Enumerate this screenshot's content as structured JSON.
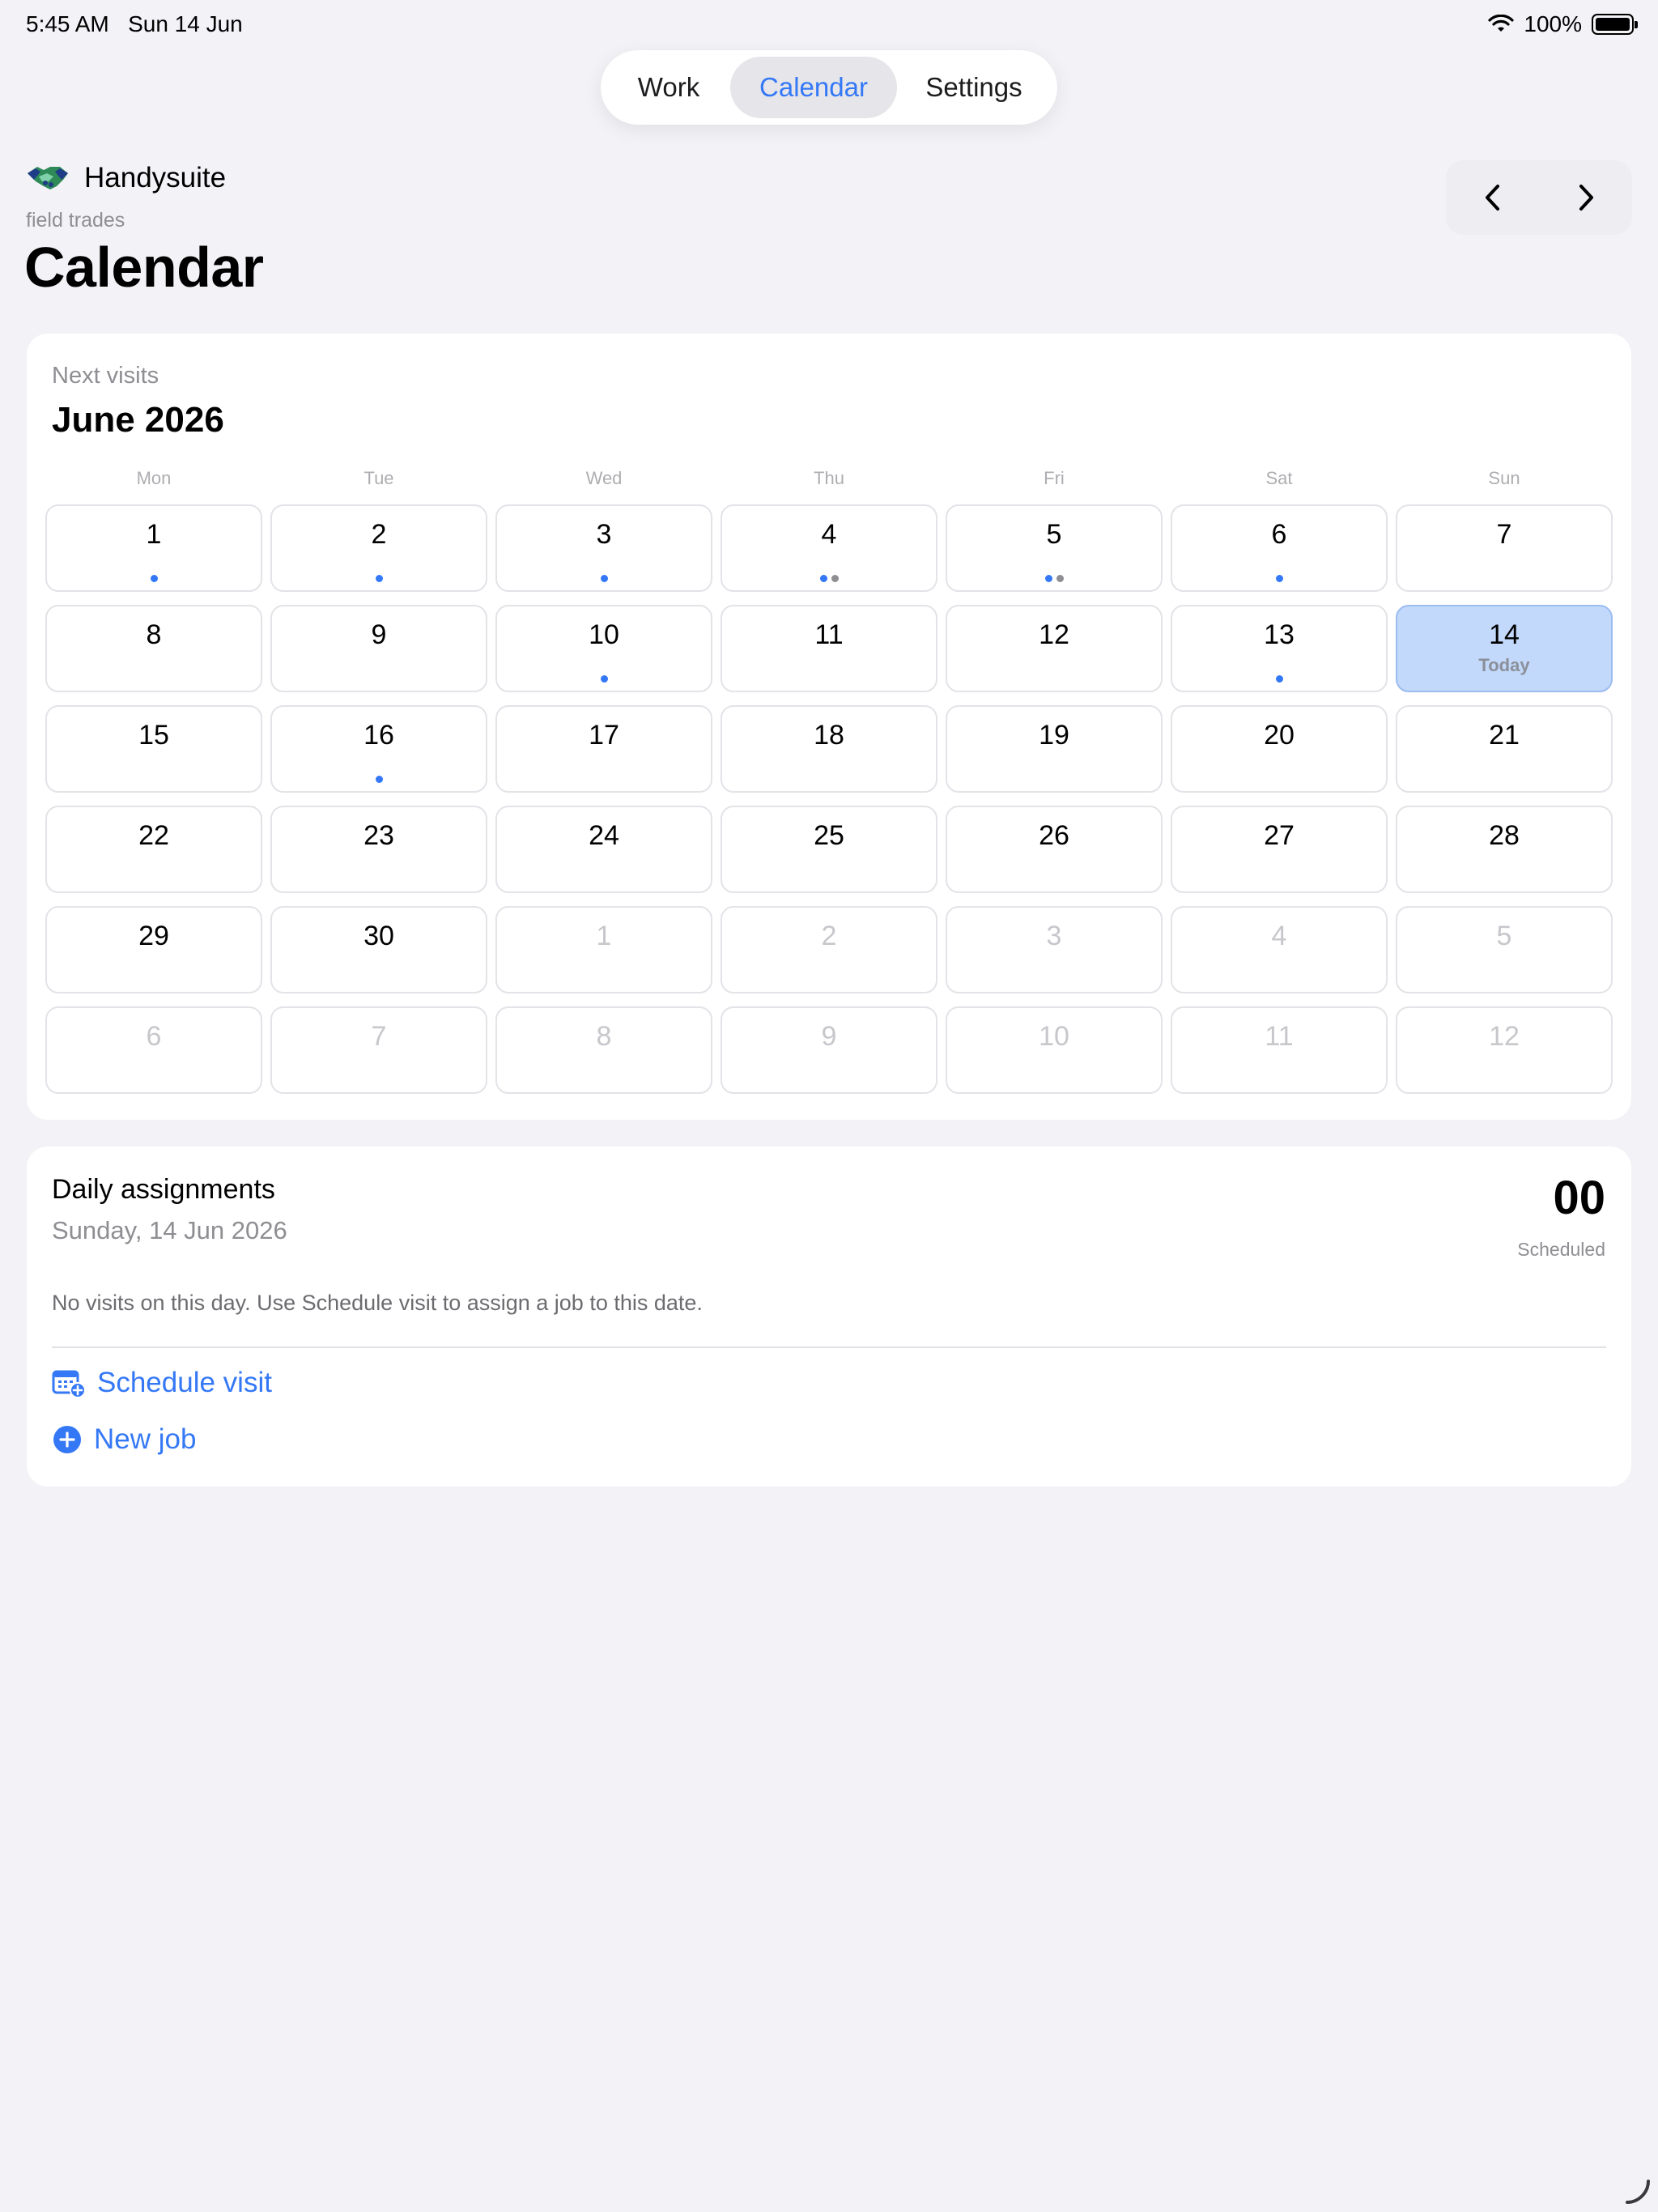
{
  "status_bar": {
    "time": "5:45 AM",
    "date": "Sun 14 Jun",
    "battery": "100%"
  },
  "tabs": [
    {
      "label": "Work",
      "selected": false
    },
    {
      "label": "Calendar",
      "selected": true
    },
    {
      "label": "Settings",
      "selected": false
    }
  ],
  "header": {
    "brand_name": "Handysuite",
    "brand_subtitle": "field trades",
    "title": "Calendar"
  },
  "calendar": {
    "overline": "Next visits",
    "month_label": "June 2026",
    "weekdays": [
      "Mon",
      "Tue",
      "Wed",
      "Thu",
      "Fri",
      "Sat",
      "Sun"
    ],
    "today_label": "Today",
    "days": [
      {
        "n": "1",
        "other": false,
        "dots": [
          "blue"
        ]
      },
      {
        "n": "2",
        "other": false,
        "dots": [
          "blue"
        ]
      },
      {
        "n": "3",
        "other": false,
        "dots": [
          "blue"
        ]
      },
      {
        "n": "4",
        "other": false,
        "dots": [
          "blue",
          "gray"
        ]
      },
      {
        "n": "5",
        "other": false,
        "dots": [
          "blue",
          "gray"
        ]
      },
      {
        "n": "6",
        "other": false,
        "dots": [
          "blue"
        ]
      },
      {
        "n": "7",
        "other": false,
        "dots": []
      },
      {
        "n": "8",
        "other": false,
        "dots": []
      },
      {
        "n": "9",
        "other": false,
        "dots": []
      },
      {
        "n": "10",
        "other": false,
        "dots": [
          "blue"
        ]
      },
      {
        "n": "11",
        "other": false,
        "dots": []
      },
      {
        "n": "12",
        "other": false,
        "dots": []
      },
      {
        "n": "13",
        "other": false,
        "dots": [
          "blue"
        ]
      },
      {
        "n": "14",
        "other": false,
        "today": true,
        "dots": []
      },
      {
        "n": "15",
        "other": false,
        "dots": []
      },
      {
        "n": "16",
        "other": false,
        "dots": [
          "blue"
        ]
      },
      {
        "n": "17",
        "other": false,
        "dots": []
      },
      {
        "n": "18",
        "other": false,
        "dots": []
      },
      {
        "n": "19",
        "other": false,
        "dots": []
      },
      {
        "n": "20",
        "other": false,
        "dots": []
      },
      {
        "n": "21",
        "other": false,
        "dots": []
      },
      {
        "n": "22",
        "other": false,
        "dots": []
      },
      {
        "n": "23",
        "other": false,
        "dots": []
      },
      {
        "n": "24",
        "other": false,
        "dots": []
      },
      {
        "n": "25",
        "other": false,
        "dots": []
      },
      {
        "n": "26",
        "other": false,
        "dots": []
      },
      {
        "n": "27",
        "other": false,
        "dots": []
      },
      {
        "n": "28",
        "other": false,
        "dots": []
      },
      {
        "n": "29",
        "other": false,
        "dots": []
      },
      {
        "n": "30",
        "other": false,
        "dots": []
      },
      {
        "n": "1",
        "other": true,
        "dots": []
      },
      {
        "n": "2",
        "other": true,
        "dots": []
      },
      {
        "n": "3",
        "other": true,
        "dots": []
      },
      {
        "n": "4",
        "other": true,
        "dots": []
      },
      {
        "n": "5",
        "other": true,
        "dots": []
      },
      {
        "n": "6",
        "other": true,
        "dots": []
      },
      {
        "n": "7",
        "other": true,
        "dots": []
      },
      {
        "n": "8",
        "other": true,
        "dots": []
      },
      {
        "n": "9",
        "other": true,
        "dots": []
      },
      {
        "n": "10",
        "other": true,
        "dots": []
      },
      {
        "n": "11",
        "other": true,
        "dots": []
      },
      {
        "n": "12",
        "other": true,
        "dots": []
      }
    ]
  },
  "assignments": {
    "title": "Daily assignments",
    "date": "Sunday, 14 Jun 2026",
    "count": "00",
    "count_label": "Scheduled",
    "empty_message": "No visits on this day. Use Schedule visit to assign a job to this date.",
    "schedule_label": "Schedule visit",
    "new_job_label": "New job"
  },
  "colors": {
    "accent": "#3478f6",
    "dot_blue": "#3478f6",
    "dot_gray": "#8e8e93",
    "today_bg": "#c2d9fb",
    "background": "#f2f2f7"
  },
  "icons": {
    "brand": "handshake-logo-icon",
    "prev": "chevron-left-icon",
    "next": "chevron-right-icon",
    "schedule": "calendar-plus-icon",
    "new_job": "plus-circle-icon",
    "wifi": "wifi-icon",
    "battery": "battery-icon"
  }
}
